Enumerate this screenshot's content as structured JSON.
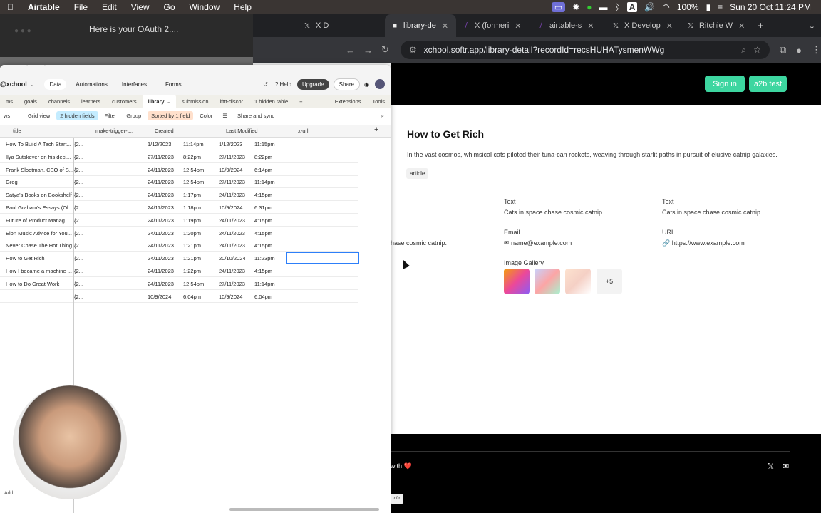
{
  "menubar": {
    "apple": "",
    "app": "Airtable",
    "items": [
      "File",
      "Edit",
      "View",
      "Go",
      "Window",
      "Help"
    ],
    "battery": "100%",
    "datetime": "Sun 20 Oct  11:24 PM"
  },
  "backwin": {
    "tab_title": "Here is your OAuth 2...."
  },
  "chrome": {
    "tabs": [
      {
        "label": "X D",
        "icon": "x-icon"
      },
      {
        "label": "library-de",
        "icon": "softr-icon",
        "active": true
      },
      {
        "label": "X (formeri",
        "icon": "phantom-icon"
      },
      {
        "label": "airtable-s",
        "icon": "phantom-icon"
      },
      {
        "label": "X Develop",
        "icon": "x-icon"
      },
      {
        "label": "Ritchie W",
        "icon": "x-icon"
      }
    ],
    "new_tab": "+",
    "url": "xchool.softr.app/library-detail?recordId=recsHUHATysmenWWg"
  },
  "page": {
    "sign_in": "Sign in",
    "user_btn": "a2b test",
    "title": "How to Get Rich",
    "description": "In the vast cosmos, whimsical cats piloted their tuna-can rockets, weaving through starlit paths in pursuit of elusive catnip galaxies.",
    "tag": "article",
    "fields": [
      {
        "label": "Text",
        "value": "Cats in space chase cosmic catnip."
      },
      {
        "label": "Text",
        "value": "Cats in space chase cosmic catnip."
      },
      {
        "label": "",
        "value": "hase cosmic catnip."
      },
      {
        "label": "Email",
        "value": "name@example.com"
      },
      {
        "label": "URL",
        "value": "https://www.example.com"
      }
    ],
    "gallery_label": "Image Gallery",
    "gallery_more": "+5",
    "footer_text": "with ❤️"
  },
  "airtable": {
    "workspace": "@xchool",
    "nav": [
      "Data",
      "Automations",
      "Interfaces",
      "Forms"
    ],
    "help": "Help",
    "upgrade": "Upgrade",
    "share": "Share",
    "tables": [
      "ms",
      "goals",
      "channels",
      "learners",
      "customers",
      "library",
      "submission",
      "ifttt-discor",
      "1 hidden table"
    ],
    "extensions": "Extensions",
    "tools": "Tools",
    "toolbar": {
      "views": "ws",
      "grid_view": "Grid view",
      "hidden": "2 hidden fields",
      "filter": "Filter",
      "group": "Group",
      "sorted": "Sorted by 1 field",
      "color": "Color",
      "share_sync": "Share and sync"
    },
    "columns": [
      "title",
      "make-trigger-t...",
      "Created",
      "Last Modified",
      "x-url"
    ],
    "rows": [
      {
        "title": "How To Build A Tech Start...",
        "m": "{2...",
        "cd": "1/12/2023",
        "ct": "11:14pm",
        "md": "1/12/2023",
        "mt": "11:15pm"
      },
      {
        "title": "Ilya Sutskever on his deci...",
        "m": "{2...",
        "cd": "27/11/2023",
        "ct": "8:22pm",
        "md": "27/11/2023",
        "mt": "8:22pm"
      },
      {
        "title": "Frank Slootman, CEO of S...",
        "m": "{2...",
        "cd": "24/11/2023",
        "ct": "12:54pm",
        "md": "10/9/2024",
        "mt": "6:14pm"
      },
      {
        "title": "Greg",
        "m": "{2...",
        "cd": "24/11/2023",
        "ct": "12:54pm",
        "md": "27/11/2023",
        "mt": "11:14pm"
      },
      {
        "title": "Satya's Books on Bookshelf",
        "m": "{2...",
        "cd": "24/11/2023",
        "ct": "1:17pm",
        "md": "24/11/2023",
        "mt": "4:15pm"
      },
      {
        "title": "Paul Graham's Essays (Ol...",
        "m": "{2...",
        "cd": "24/11/2023",
        "ct": "1:18pm",
        "md": "10/9/2024",
        "mt": "6:31pm"
      },
      {
        "title": "Future of Product Manag...",
        "m": "{2...",
        "cd": "24/11/2023",
        "ct": "1:19pm",
        "md": "24/11/2023",
        "mt": "4:15pm"
      },
      {
        "title": "Elon Musk: Advice for You...",
        "m": "{2...",
        "cd": "24/11/2023",
        "ct": "1:20pm",
        "md": "24/11/2023",
        "mt": "4:15pm"
      },
      {
        "title": "Never Chase The Hot Thing",
        "m": "{2...",
        "cd": "24/11/2023",
        "ct": "1:21pm",
        "md": "24/11/2023",
        "mt": "4:15pm"
      },
      {
        "title": "How to Get Rich",
        "m": "{2...",
        "cd": "24/11/2023",
        "ct": "1:21pm",
        "md": "20/10/2024",
        "mt": "11:23pm"
      },
      {
        "title": "How I became a machine ...",
        "m": "{2...",
        "cd": "24/11/2023",
        "ct": "1:22pm",
        "md": "24/11/2023",
        "mt": "4:15pm"
      },
      {
        "title": "How to Do Great Work",
        "m": "{2...",
        "cd": "24/11/2023",
        "ct": "12:54pm",
        "md": "27/11/2023",
        "mt": "11:14pm"
      },
      {
        "title": "",
        "m": "{2...",
        "cd": "10/9/2024",
        "ct": "6:04pm",
        "md": "10/9/2024",
        "mt": "6:04pm"
      }
    ],
    "add_desc": "Add...",
    "softr": "oftr"
  }
}
